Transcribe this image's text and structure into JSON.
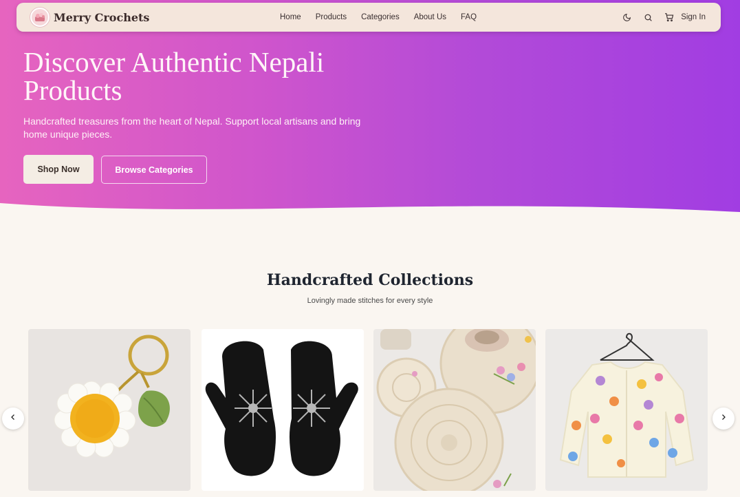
{
  "brand": {
    "name": "Merry Crochets",
    "logo_icon": "yarn-basket-icon"
  },
  "nav": {
    "links": [
      "Home",
      "Products",
      "Categories",
      "About Us",
      "FAQ"
    ],
    "icons": [
      "moon-icon",
      "search-icon",
      "cart-icon"
    ],
    "signin": "Sign In"
  },
  "hero": {
    "title": "Discover Authentic Nepali Products",
    "subtitle": "Handcrafted treasures from the heart of Nepal. Support local artisans and bring home unique pieces.",
    "primary_button": "Shop Now",
    "secondary_button": "Browse Categories",
    "gradient": [
      "#e664bf",
      "#a13de2"
    ]
  },
  "collections": {
    "title": "Handcrafted Collections",
    "subtitle": "Lovingly made stitches for every style",
    "items": [
      {
        "image": "daisy-keychain-image"
      },
      {
        "image": "black-mittens-image"
      },
      {
        "image": "crochet-coasters-image"
      },
      {
        "image": "flower-cardigan-image"
      }
    ],
    "prev_icon": "chevron-left-icon",
    "next_icon": "chevron-right-icon"
  },
  "colors": {
    "background": "#faf6f1",
    "nav_bg": "#f4e6dc",
    "text_dark": "#1f2530"
  }
}
